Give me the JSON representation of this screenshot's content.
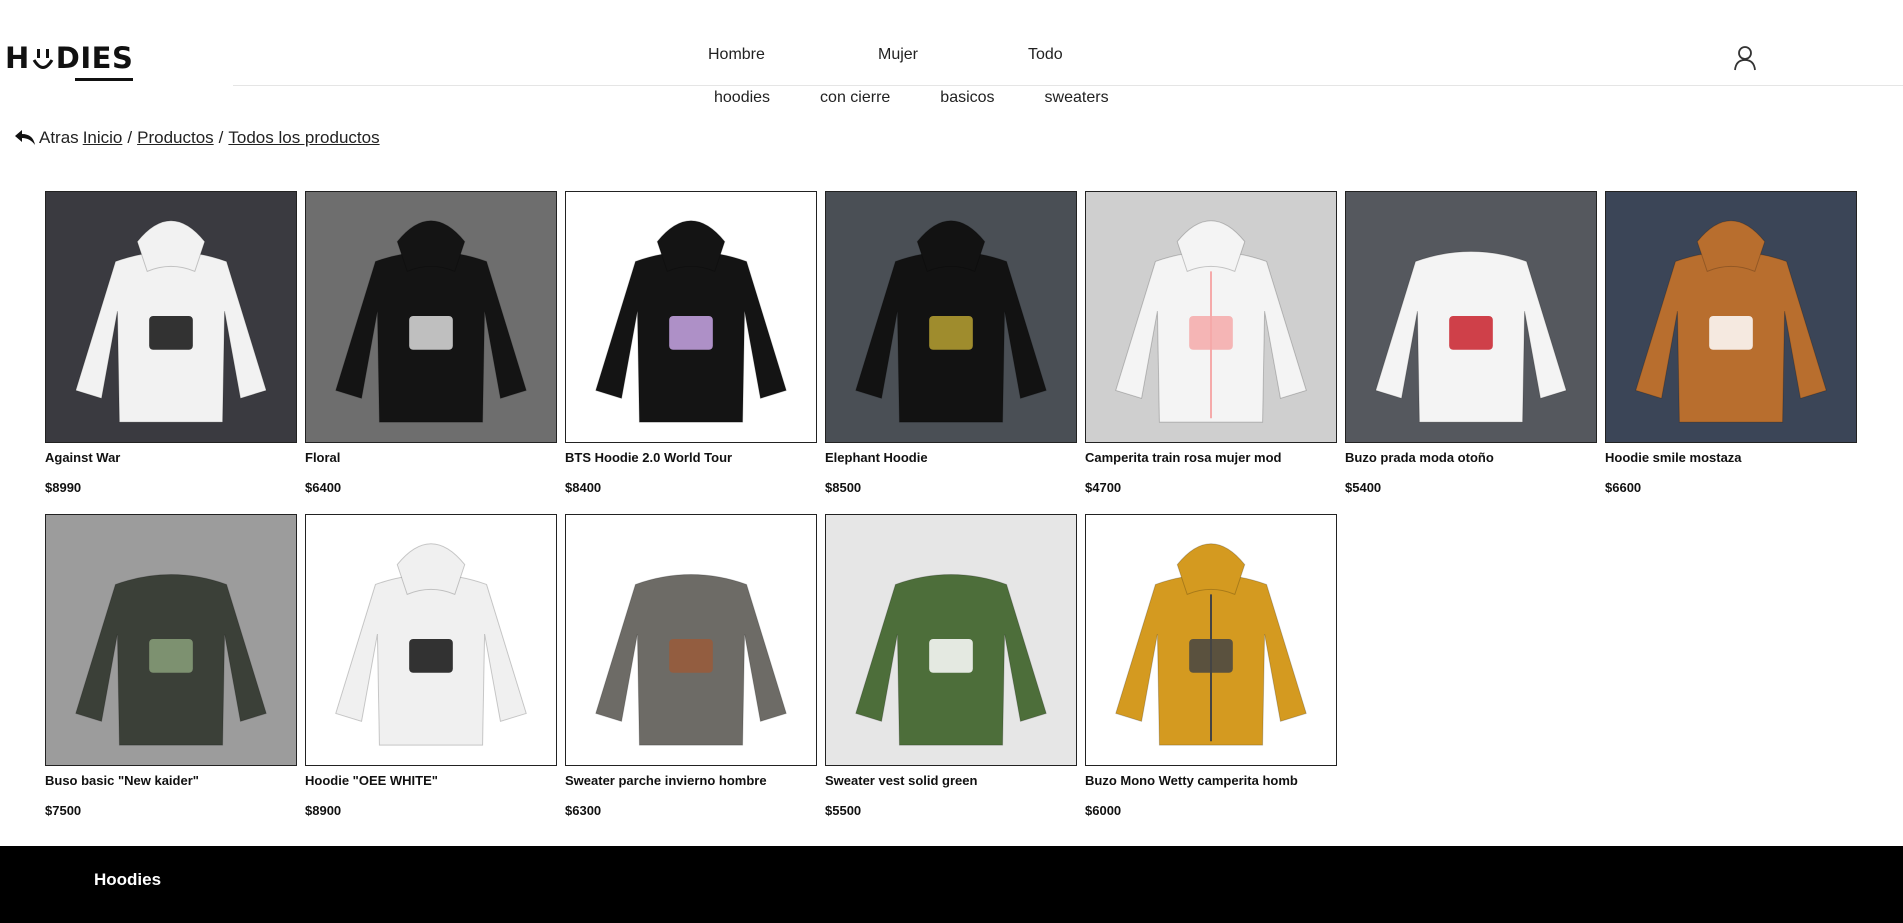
{
  "brand": {
    "logo_left": "H",
    "logo_right": "DIES"
  },
  "nav": {
    "main": [
      "Hombre",
      "Mujer",
      "Todo"
    ],
    "sub": [
      "hoodies",
      "con cierre",
      "basicos",
      "sweaters"
    ]
  },
  "breadcrumb": {
    "back_label": "Atras",
    "items": [
      "Inicio",
      "Productos",
      "Todos los productos"
    ],
    "separator": "/"
  },
  "products": [
    {
      "name": "Against War",
      "price": "$8990",
      "colors": {
        "bg": "#3a3a40",
        "body": "#f2f2f2",
        "accent": "#111111"
      }
    },
    {
      "name": "Floral",
      "price": "$6400",
      "colors": {
        "bg": "#6e6e6e",
        "body": "#141414",
        "accent": "#dddddd"
      }
    },
    {
      "name": "BTS Hoodie 2.0 World Tour",
      "price": "$8400",
      "colors": {
        "bg": "#ffffff",
        "body": "#141414",
        "accent": "#c9a6e6"
      }
    },
    {
      "name": "Elephant Hoodie",
      "price": "$8500",
      "colors": {
        "bg": "#4a4f55",
        "body": "#121212",
        "accent": "#b8a232"
      }
    },
    {
      "name": "Camperita train rosa mujer mod",
      "price": "$4700",
      "colors": {
        "bg": "#cfcfcf",
        "body": "#f4f4f4",
        "accent": "#f5a9a9"
      }
    },
    {
      "name": "Buzo prada moda otoño",
      "price": "$5400",
      "colors": {
        "bg": "#55585e",
        "body": "#f4f4f4",
        "accent": "#c8202a"
      }
    },
    {
      "name": "Hoodie smile mostaza",
      "price": "$6600",
      "colors": {
        "bg": "#3b4557",
        "body": "#b86e2e",
        "accent": "#ffffff"
      }
    },
    {
      "name": "Buso basic \"New kaider\"",
      "price": "$7500",
      "colors": {
        "bg": "#9c9c9c",
        "body": "#3b4038",
        "accent": "#8aa07a"
      }
    },
    {
      "name": "Hoodie \"OEE WHITE\"",
      "price": "$8900",
      "colors": {
        "bg": "#ffffff",
        "body": "#f0f0f0",
        "accent": "#111111"
      }
    },
    {
      "name": "Sweater parche invierno hombre",
      "price": "$6300",
      "colors": {
        "bg": "#ffffff",
        "body": "#6d6b66",
        "accent": "#9a5b3a"
      }
    },
    {
      "name": "Sweater vest solid green",
      "price": "$5500",
      "colors": {
        "bg": "#e6e6e6",
        "body": "#4d6e3a",
        "accent": "#ffffff"
      }
    },
    {
      "name": "Buzo Mono Wetty camperita homb",
      "price": "$6000",
      "colors": {
        "bg": "#ffffff",
        "body": "#d49a20",
        "accent": "#444444"
      }
    }
  ],
  "footer": {
    "brand": "Hoodies"
  }
}
